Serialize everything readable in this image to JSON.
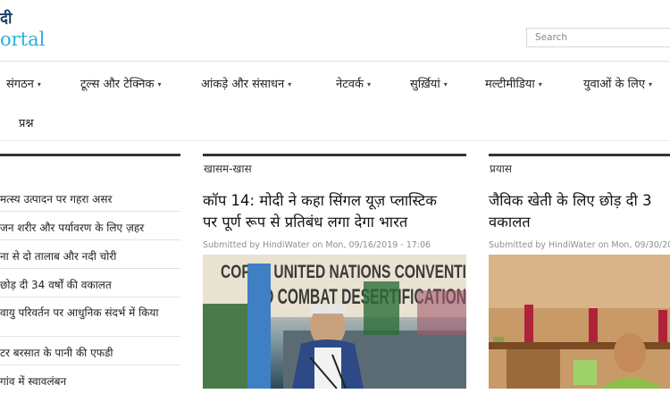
{
  "header": {
    "logo_line1": "दी",
    "logo_line2": "ortal",
    "search_placeholder": "Search"
  },
  "nav": {
    "items": [
      {
        "label": "संगठन"
      },
      {
        "label": "टूल्स और टेक्निक"
      },
      {
        "label": "आंकड़े और संसाधन"
      },
      {
        "label": "नेटवर्क"
      },
      {
        "label": "सुर्ख़ियां"
      },
      {
        "label": "मल्टीमीडिया"
      },
      {
        "label": "युवाओं के लिए"
      }
    ],
    "caret": "▾",
    "second_row": "प्रश्न"
  },
  "columns": {
    "col2_heading": "खासम-खास",
    "col3_heading": "प्रयास"
  },
  "list": {
    "items": [
      "मत्स्य उत्पादन पर गहरा असर",
      "जन शरीर और पर्यावरण के लिए ज़हर",
      "ना से दो तालाब और नदी चोरी",
      "छोड़ दी 34 वर्षों की वकालत",
      "वायु परिवर्तन पर आधुनिक संदर्भ में किया",
      "टर बरसात के पानी की एफडी",
      "गांव में स्वावलंबन"
    ]
  },
  "article1": {
    "title_line1": "कॉप 14: मोदी ने कहा सिंगल यूज़ प्लास्टिक",
    "title_line2": "पर पूर्ण रूप से प्रतिबंध लगा देगा भारत",
    "meta": "Submitted by HindiWater on Mon, 09/16/2019 - 17:06",
    "banner_line1": "COP 14 UNITED NATIONS CONVENTI",
    "banner_line2": "TO COMBAT DESERTIFICATION"
  },
  "article2": {
    "title_line1": "जैविक खेती के लिए छोड़ दी 3",
    "title_line2": "वकालत",
    "meta": "Submitted by HindiWater on Mon, 09/30/20"
  },
  "colors": {
    "logo_dark": "#1b3f6a",
    "logo_light": "#2bb0d9",
    "heading_border": "#333333"
  }
}
